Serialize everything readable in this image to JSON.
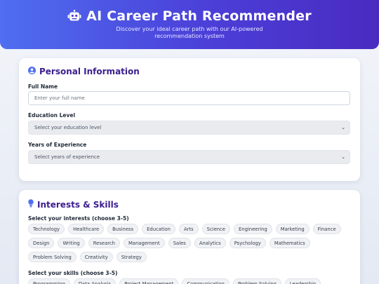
{
  "header": {
    "title": "AI Career Path Recommender",
    "subtitle": "Discover your ideal career path with our AI-powered recommendation system"
  },
  "personal": {
    "title": "Personal Information",
    "full_name_label": "Full Name",
    "full_name_placeholder": "Enter your full name",
    "education_label": "Education Level",
    "education_value": "Select your education level",
    "experience_label": "Years of Experience",
    "experience_value": "Select years of experience"
  },
  "interests_skills": {
    "title": "Interests & Skills",
    "interests_label": "Select your interests (choose 3-5)",
    "interests": [
      "Technology",
      "Healthcare",
      "Business",
      "Education",
      "Arts",
      "Science",
      "Engineering",
      "Marketing",
      "Finance",
      "Design",
      "Writing",
      "Research",
      "Management",
      "Sales",
      "Analytics",
      "Psychology",
      "Mathematics",
      "Problem Solving",
      "Creativity",
      "Strategy"
    ],
    "skills_label": "Select your skills (choose 3-5)",
    "skills": [
      "Programming",
      "Data Analysis",
      "Project Management",
      "Communication",
      "Problem Solving",
      "Leadership"
    ]
  },
  "colors": {
    "accent": "#4b3fd8",
    "section_title": "#3b1d8f",
    "icon_blue": "#4f6ef0"
  },
  "icons": {
    "header": "robot-icon",
    "personal": "user-circle-icon",
    "interests": "lightbulb-icon",
    "select": "chevron-down-icon"
  }
}
